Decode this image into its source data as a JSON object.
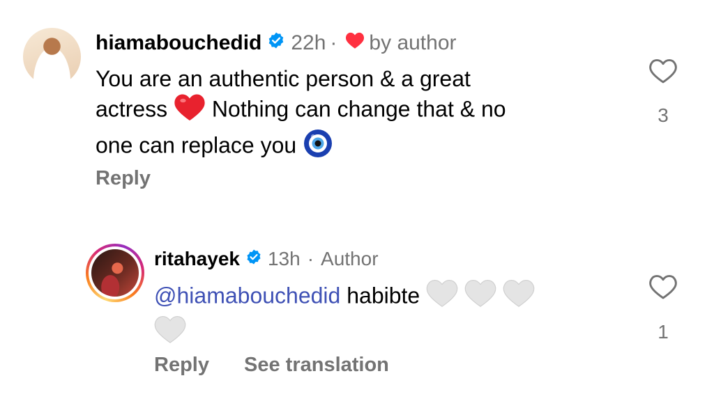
{
  "comment1": {
    "username": "hiamabouchedid",
    "time": "22h",
    "separator": "·",
    "liked_label": "by author",
    "line1": "You are an authentic person & a great",
    "line2a": "actress",
    "line2b": "Nothing can change that & no",
    "line3": "one can replace you",
    "reply": "Reply",
    "like_count": "3"
  },
  "comment2": {
    "username": "ritahayek",
    "time": "13h",
    "separator": "·",
    "author_label": "Author",
    "mention": "@hiamabouchedid",
    "text": "habibte",
    "reply": "Reply",
    "see_translation": "See translation",
    "like_count": "1"
  },
  "icons": {
    "verified": "verified-badge-icon",
    "heart_outline": "heart-outline-icon",
    "heart_red": "red-heart-emoji",
    "heart_white": "white-heart-emoji",
    "evil_eye": "nazar-amulet-emoji"
  },
  "colors": {
    "verified_blue": "#0095f6",
    "meta_gray": "#737373",
    "mention_blue": "#3f51b5",
    "heart_red": "#ff3040"
  }
}
